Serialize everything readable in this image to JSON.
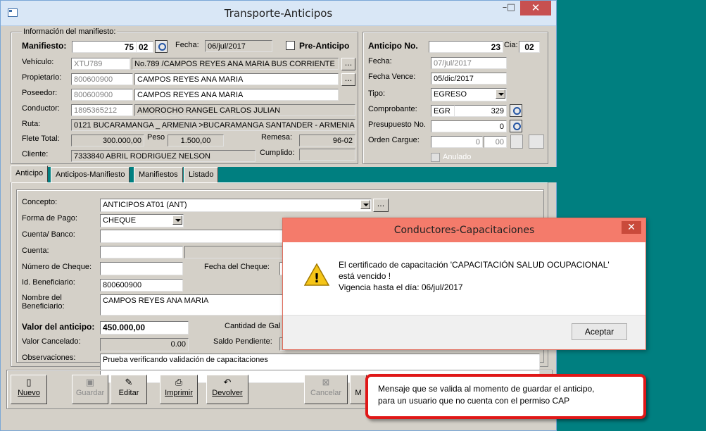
{
  "window": {
    "title": "Transporte-Anticipos",
    "minimize": "–",
    "maximize": "□",
    "close": "✕"
  },
  "manifest": {
    "group_title": "Información del manifiesto:",
    "manifiesto_label": "Manifiesto:",
    "manifiesto_no": "75",
    "manifiesto_code": "02",
    "fecha_label": "Fecha:",
    "fecha": "06/jul/2017",
    "pre_anticipo_label": "Pre-Anticipo",
    "vehiculo_label": "Vehículo:",
    "vehiculo_placa": "XTU789",
    "vehiculo_desc": "No.789 /CAMPOS REYES ANA MARIA BUS CORRIENTE",
    "propietario_label": "Propietario:",
    "propietario_id": "800600900",
    "propietario_nombre": "CAMPOS REYES ANA MARIA",
    "poseedor_label": "Poseedor:",
    "poseedor_id": "800600900",
    "poseedor_nombre": "CAMPOS REYES ANA MARIA",
    "conductor_label": "Conductor:",
    "conductor_id": "1895365212",
    "conductor_nombre": "AMOROCHO RANGEL CARLOS JULIAN",
    "ruta_label": "Ruta:",
    "ruta": "0121 BUCARAMANGA _ ARMENIA >BUCARAMANGA SANTANDER - ARMENIA",
    "flete_label": "Flete Total:",
    "flete": "300.000,00",
    "peso_label": "Peso",
    "peso": "1.500,00",
    "remesa_label": "Remesa:",
    "remesa": "96-02",
    "cliente_label": "Cliente:",
    "cliente": "7333840 ABRIL RODRIGUEZ NELSON",
    "cumplido_label": "Cumplido:",
    "ellipsis": "..."
  },
  "anticipo": {
    "no_label": "Anticipo No.",
    "no": "23",
    "cia_label": "Cia:",
    "cia": "02",
    "fecha_label": "Fecha:",
    "fecha": "07/jul/2017",
    "fecha_vence_label": "Fecha Vence:",
    "fecha_vence": "05/dic/2017",
    "tipo_label": "Tipo:",
    "tipo": "EGRESO",
    "comprobante_label": "Comprobante:",
    "comprobante_tipo": "EGR",
    "comprobante_no": "329",
    "presupuesto_label": "Presupuesto No.",
    "presupuesto": "0",
    "orden_label": "Orden Cargue:",
    "orden": "0",
    "orden_code": "00",
    "anulado_label": "Anulado"
  },
  "tabs": [
    "Anticipo",
    "Anticipos-Manifiesto",
    "Manifiestos",
    "Listado"
  ],
  "form": {
    "concepto_label": "Concepto:",
    "concepto": "ANTICIPOS AT01  (ANT)",
    "forma_pago_label": "Forma de Pago:",
    "forma_pago": "CHEQUE",
    "cuenta_banco_label": "Cuenta/ Banco:",
    "cuenta_label": "Cuenta:",
    "numero_cheque_label": "Número de Cheque:",
    "fecha_cheque_label": "Fecha del Cheque:",
    "id_beneficiario_label": "Id. Beneficiario:",
    "id_beneficiario": "800600900",
    "nombre_beneficiario_label": "Nombre del Beneficiario:",
    "nombre_beneficiario": "CAMPOS REYES ANA MARIA",
    "valor_anticipo_label": "Valor del anticipo:",
    "valor_anticipo": "450.000,00",
    "cantidad_label": "Cantidad de Gal",
    "valor_cancelado_label": "Valor Cancelado:",
    "valor_cancelado": "0.00",
    "saldo_label": "Saldo Pendiente:",
    "observaciones_label": "Observaciones:",
    "observaciones": "Prueba verificando validación de capacitaciones"
  },
  "toolbar": {
    "nuevo": "Nuevo",
    "guardar": "Guardar",
    "editar": "Editar",
    "imprimir": "Imprimir",
    "devolver": "Devolver",
    "cancelar": "Cancelar",
    "more": "M"
  },
  "dialog": {
    "title": "Conductores-Capacitaciones",
    "close": "✕",
    "line1": "El certificado de capacitación 'CAPACITACIÓN SALUD OCUPACIONAL'",
    "line2": "está vencido !",
    "line3": "Vigencia hasta el día: 06/jul/2017",
    "ok": "Aceptar",
    "warning_glyph": "!"
  },
  "callout": {
    "line1": "Mensaje que se valida al momento de guardar el anticipo,",
    "line2": "para un usuario que no cuenta con el permiso CAP"
  }
}
